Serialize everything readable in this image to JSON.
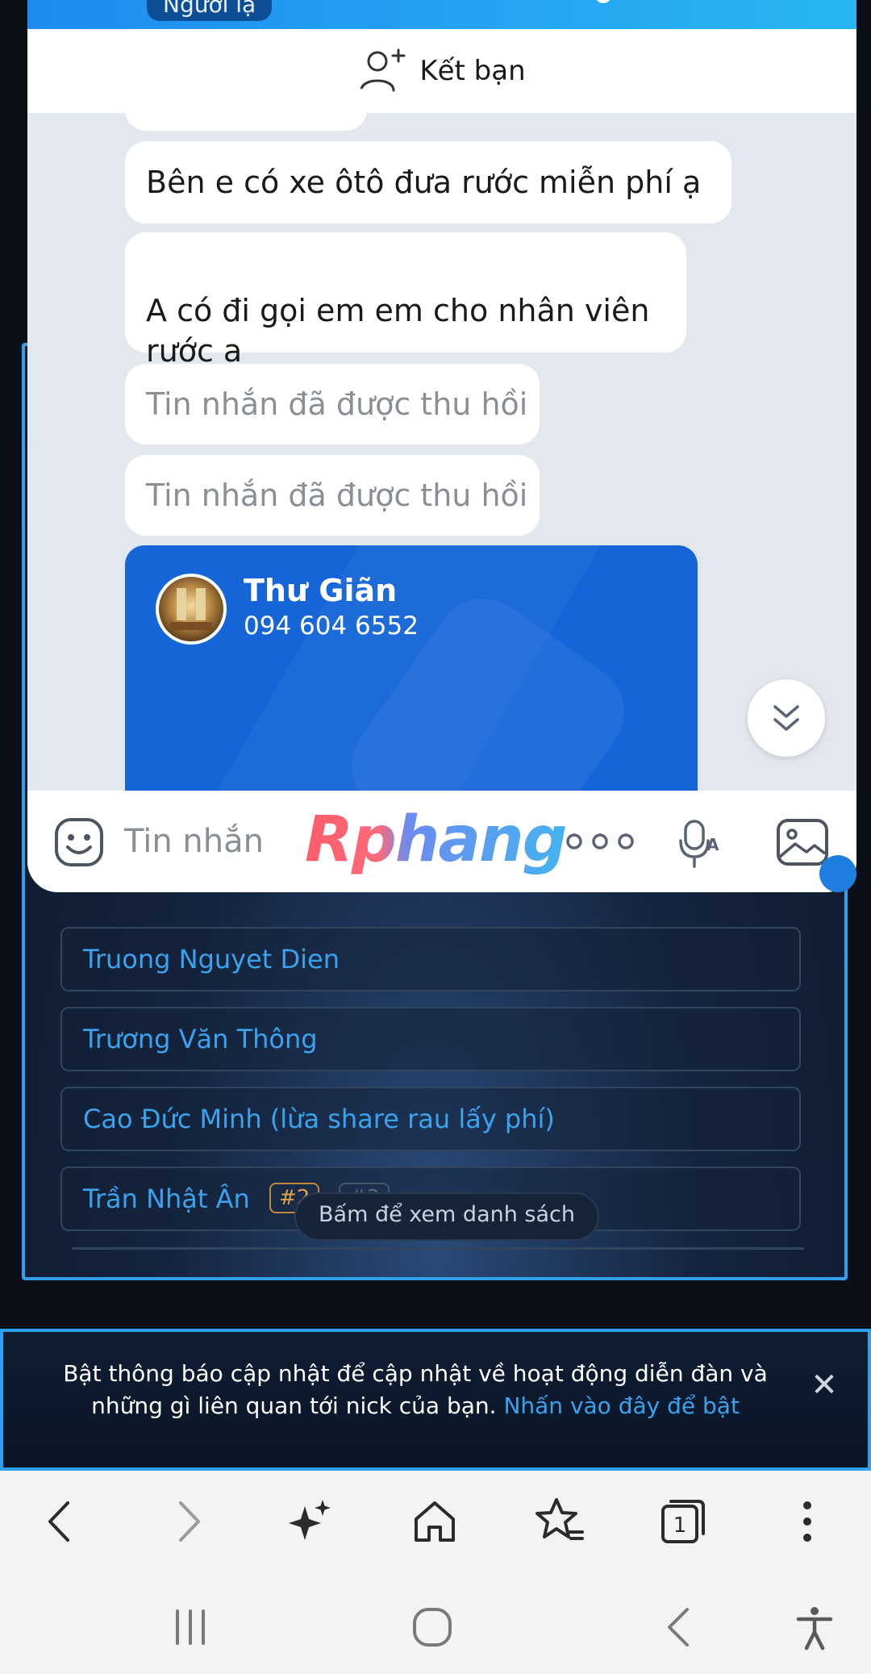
{
  "chat": {
    "stranger_badge": "Người lạ",
    "add_friend_label": "Kết bạn",
    "messages": [
      {
        "text": "Bên e có xe ôtô đưa rước miễn phí ạ",
        "recalled": false
      },
      {
        "text": "A có đi gọi em em cho nhân viên\nrước a",
        "recalled": false
      },
      {
        "text": "Tin nhắn đã được thu hồi",
        "recalled": true
      },
      {
        "text": "Tin nhắn đã được thu hồi",
        "recalled": true
      }
    ],
    "contact_card": {
      "name": "Thư Giãn",
      "phone": "094 604 6552"
    },
    "composer": {
      "placeholder": "Tin nhắn"
    },
    "watermark": "Rphang",
    "icons": {
      "add_friend": "add-person-icon",
      "scroll_down": "double-chevron-down-icon",
      "sticker": "sticker-face-icon",
      "more": "more-dots-icon",
      "voice": "voice-to-text-icon",
      "image": "image-icon"
    }
  },
  "forum_list": {
    "items": [
      {
        "label": "Truong Nguyet Dien"
      },
      {
        "label": "Trương Văn Thông"
      },
      {
        "label": "Cao Đức Minh (lừa share rau lấy phí)"
      },
      {
        "label": "Trần Nhật Ân",
        "tags": [
          "#2",
          "#3"
        ]
      }
    ],
    "tooltip": "Bấm để xem danh sách"
  },
  "notification": {
    "text": "Bật thông báo cập nhật để cập nhật về hoạt động diễn đàn và những gì liên quan tới nick của bạn.",
    "link_text": "Nhấn vào đây để bật",
    "close_symbol": "✕"
  },
  "browser_toolbar": {
    "icons": [
      "back-icon",
      "forward-icon",
      "ai-sparkle-icon",
      "home-icon",
      "bookmarks-star-icon",
      "tabs-icon",
      "more-vertical-icon"
    ],
    "tab_count": "1"
  },
  "nav_bar": {
    "icons": [
      "recent-apps-icon",
      "home-circle-icon",
      "nav-back-icon",
      "accessibility-icon"
    ]
  },
  "colors": {
    "accent_blue": "#2ea1f0",
    "link_blue": "#3aa3ef",
    "card_blue": "#1565d8",
    "chat_bg": "#e3e8ef"
  }
}
